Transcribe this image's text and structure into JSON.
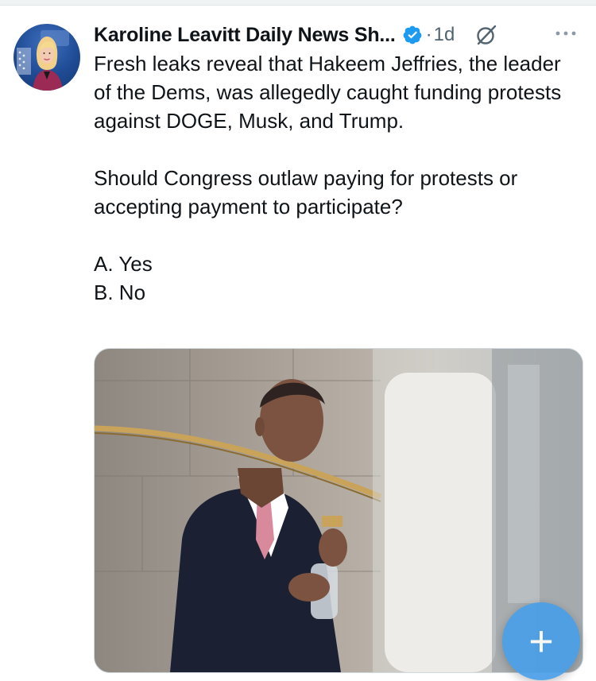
{
  "tweet": {
    "display_name": "Karoline Leavitt Daily News Sh...",
    "separator": "·",
    "timestamp": "1d",
    "paragraphs": [
      "Fresh leaks reveal that Hakeem Jeffries, the leader of the Dems, was allegedly caught funding protests against DOGE, Musk, and Trump.",
      "Should Congress outlaw paying for protests or accepting payment to participate?",
      "A. Yes",
      "B. No"
    ]
  },
  "icons": {
    "verified": "verified-badge-icon",
    "grok": "grok-icon",
    "more": "more-options-icon",
    "compose": "compose-plus-icon"
  },
  "compose_button": {
    "label": "+"
  },
  "colors": {
    "verified_blue": "#1d9bf0",
    "text": "#0f1419",
    "secondary_text": "#536471",
    "fab_blue": "#4a9fe8"
  }
}
